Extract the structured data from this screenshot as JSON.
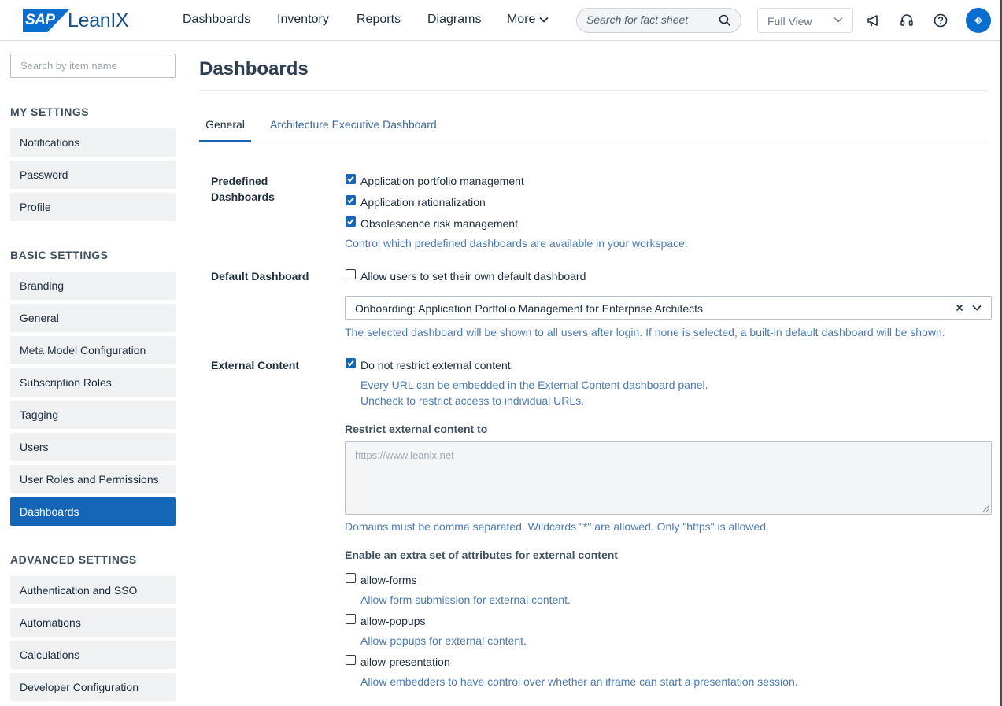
{
  "header": {
    "logo_sap": "SAP",
    "logo_product": "LeanIX",
    "nav": [
      "Dashboards",
      "Inventory",
      "Reports",
      "Diagrams",
      "More"
    ],
    "search_placeholder": "Search for fact sheet",
    "view_select": "Full View",
    "icons": [
      "megaphone-icon",
      "headset-icon",
      "help-icon",
      "user-avatar"
    ]
  },
  "sidebar": {
    "search_placeholder": "Search by item name",
    "sections": [
      {
        "title": "MY SETTINGS",
        "items": [
          "Notifications",
          "Password",
          "Profile"
        ]
      },
      {
        "title": "BASIC SETTINGS",
        "items": [
          "Branding",
          "General",
          "Meta Model Configuration",
          "Subscription Roles",
          "Tagging",
          "Users",
          "User Roles and Permissions",
          "Dashboards"
        ]
      },
      {
        "title": "ADVANCED SETTINGS",
        "items": [
          "Authentication and SSO",
          "Automations",
          "Calculations",
          "Developer Configuration"
        ]
      }
    ],
    "active_item": "Dashboards"
  },
  "main": {
    "title": "Dashboards",
    "tabs": [
      "General",
      "Architecture Executive Dashboard"
    ],
    "active_tab": "General",
    "predefined": {
      "label": "Predefined Dashboards",
      "label_line1": "Predefined",
      "label_line2": "Dashboards",
      "options": [
        {
          "label": "Application portfolio management",
          "checked": true
        },
        {
          "label": "Application rationalization",
          "checked": true
        },
        {
          "label": "Obsolescence risk management",
          "checked": true
        }
      ],
      "help": "Control which predefined dashboards are available in your workspace."
    },
    "default_dashboard": {
      "label": "Default Dashboard",
      "checkbox_label": "Allow users to set their own default dashboard",
      "checked": false,
      "selected_value": "Onboarding: Application Portfolio Management for Enterprise Architects",
      "help": "The selected dashboard will be shown to all users after login. If none is selected, a built-in default dashboard will be shown."
    },
    "external_content": {
      "label": "External Content",
      "checkbox_label": "Do not restrict external content",
      "checked": true,
      "help_line1": "Every URL can be embedded in the External Content dashboard panel.",
      "help_line2": "Uncheck to restrict access to individual URLs.",
      "restrict_label": "Restrict external content to",
      "restrict_placeholder": "https://www.leanix.net",
      "restrict_help": "Domains must be comma separated. Wildcards \"*\" are allowed. Only \"https\" is allowed.",
      "extra_label": "Enable an extra set of attributes for external content",
      "attributes": [
        {
          "name": "allow-forms",
          "desc": "Allow form submission for external content.",
          "checked": false
        },
        {
          "name": "allow-popups",
          "desc": "Allow popups for external content.",
          "checked": false
        },
        {
          "name": "allow-presentation",
          "desc": "Allow embedders to have control over whether an iframe can start a presentation session.",
          "checked": false
        }
      ]
    }
  },
  "colors": {
    "primary": "#1565b8",
    "link": "#4b7bb0",
    "sidebar_item_bg": "#eff1f3"
  }
}
